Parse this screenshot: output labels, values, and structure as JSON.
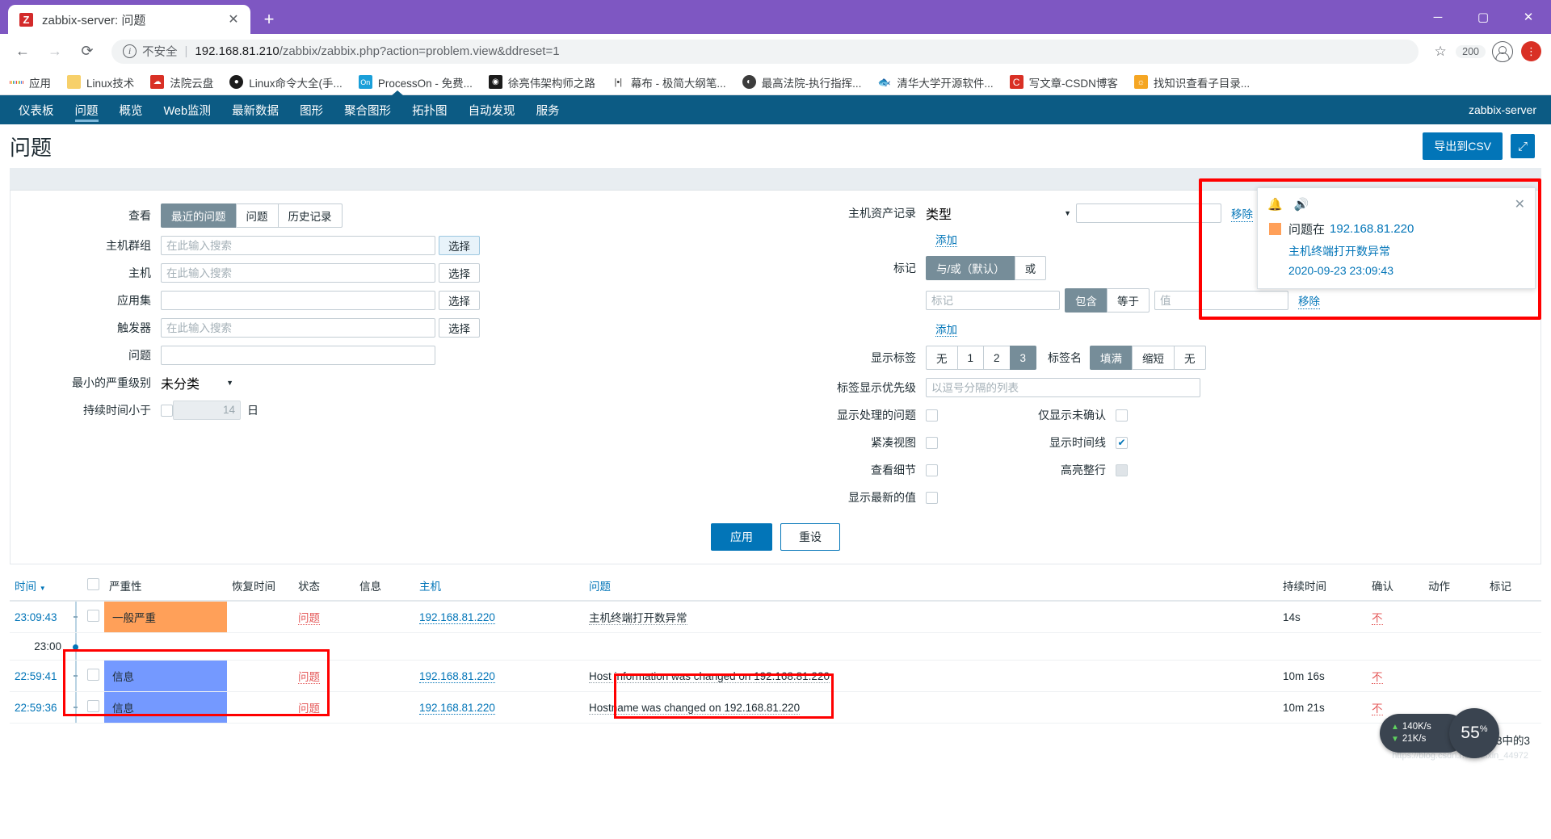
{
  "browser": {
    "tab": {
      "title": "zabbix-server: 问题",
      "favicon_letter": "Z",
      "close_label": "✕"
    },
    "new_tab_label": "+",
    "window": {
      "minimize": "─",
      "maximize": "▢",
      "close": "✕"
    },
    "nav": {
      "back": "←",
      "forward": "→",
      "reload": "⟳"
    },
    "omnibox": {
      "security_label": "不安全",
      "separator": "|",
      "url_host": "192.168.81.210",
      "url_path": "/zabbix/zabbix.php?action=problem.view&ddreset=1",
      "star": "☆"
    },
    "extension_badge": "200",
    "bookmarks": [
      {
        "label": "应用",
        "icon": "apps-grid-icon"
      },
      {
        "label": "Linux技术",
        "icon": "folder-icon"
      },
      {
        "label": "法院云盘",
        "icon": "cloud-disk-icon"
      },
      {
        "label": "Linux命令大全(手...",
        "icon": "redhat-icon"
      },
      {
        "label": "ProcessOn - 免费...",
        "icon": "processon-icon"
      },
      {
        "label": "徐亮伟架构师之路",
        "icon": "chrome-dark-icon"
      },
      {
        "label": "幕布 - 极简大纲笔...",
        "icon": "mubu-icon"
      },
      {
        "label": "最高法院-执行指挥...",
        "icon": "court-icon"
      },
      {
        "label": "清华大学开源软件...",
        "icon": "tuna-icon"
      },
      {
        "label": "写文章-CSDN博客",
        "icon": "csdn-icon"
      },
      {
        "label": "找知识查看子目录...",
        "icon": "knowledge-icon"
      }
    ]
  },
  "zabbix": {
    "nav_items": [
      {
        "label": "仪表板",
        "active": false
      },
      {
        "label": "问题",
        "active": true
      },
      {
        "label": "概览",
        "active": false
      },
      {
        "label": "Web监测",
        "active": false
      },
      {
        "label": "最新数据",
        "active": false
      },
      {
        "label": "图形",
        "active": false
      },
      {
        "label": "聚合图形",
        "active": false
      },
      {
        "label": "拓扑图",
        "active": false
      },
      {
        "label": "自动发现",
        "active": false
      },
      {
        "label": "服务",
        "active": false
      }
    ],
    "server_label": "zabbix-server",
    "page_title": "问题",
    "export_csv_label": "导出到CSV",
    "kiosk_icon": "expand-icon"
  },
  "filter": {
    "view": {
      "label": "查看",
      "options": [
        "最近的问题",
        "问题",
        "历史记录"
      ],
      "selected": "最近的问题"
    },
    "host_group": {
      "label": "主机群组",
      "value": "",
      "placeholder": "在此输入搜索",
      "select_label": "选择"
    },
    "host": {
      "label": "主机",
      "value": "",
      "placeholder": "在此输入搜索",
      "select_label": "选择"
    },
    "app_set": {
      "label": "应用集",
      "value": "",
      "placeholder": "",
      "select_label": "选择"
    },
    "trigger": {
      "label": "触发器",
      "value": "",
      "placeholder": "在此输入搜索",
      "select_label": "选择"
    },
    "problem": {
      "label": "问题",
      "value": "",
      "placeholder": ""
    },
    "min_severity": {
      "label": "最小的严重级别",
      "value": "未分类"
    },
    "duration": {
      "label": "持续时间小于",
      "checked": false,
      "value": "14",
      "unit": "日"
    },
    "inventory": {
      "label": "主机资产记录",
      "type_value": "类型",
      "value": "",
      "remove_label": "移除",
      "add_label": "添加"
    },
    "tags": {
      "label": "标记",
      "mode_options": [
        "与/或（默认）",
        "或"
      ],
      "mode_selected": "与/或（默认）",
      "tag_placeholder": "标记",
      "operator_options": [
        "包含",
        "等于"
      ],
      "operator_selected": "包含",
      "value_placeholder": "值",
      "remove_label": "移除",
      "add_label": "添加"
    },
    "show_tags": {
      "label": "显示标签",
      "options": [
        "无",
        "1",
        "2",
        "3"
      ],
      "selected": "3"
    },
    "tag_name": {
      "label": "标签名",
      "options": [
        "填满",
        "缩短",
        "无"
      ],
      "selected": "填满"
    },
    "tag_priority": {
      "label": "标签显示优先级",
      "value": "",
      "placeholder": "以逗号分隔的列表"
    },
    "checkboxes": [
      {
        "label": "显示处理的问题",
        "checked": false,
        "disabled": false
      },
      {
        "label": "紧凑视图",
        "checked": false,
        "disabled": false
      },
      {
        "label": "查看细节",
        "checked": false,
        "disabled": false
      },
      {
        "label": "显示最新的值",
        "checked": false,
        "disabled": false
      }
    ],
    "checkboxes_right": [
      {
        "label": "仅显示未确认",
        "checked": false,
        "disabled": false
      },
      {
        "label": "显示时间线",
        "checked": true,
        "disabled": false
      },
      {
        "label": "高亮整行",
        "checked": false,
        "disabled": true
      }
    ],
    "apply_label": "应用",
    "reset_label": "重设"
  },
  "table": {
    "headers": [
      "时间",
      "",
      "严重性",
      "恢复时间",
      "状态",
      "信息",
      "主机",
      "问题",
      "持续时间",
      "确认",
      "动作",
      "标记"
    ],
    "sort_indicator": "▼",
    "rows": [
      {
        "time": "23:09:43",
        "severity": "一般严重",
        "severity_class": "sev-average",
        "recovery_time": "",
        "status": "问题",
        "info": "",
        "host": "192.168.81.220",
        "problem": "主机终端打开数异常",
        "duration": "14s",
        "ack": "不",
        "actions": "",
        "tags": ""
      },
      {
        "time": "22:59:41",
        "severity": "信息",
        "severity_class": "sev-info",
        "recovery_time": "",
        "status": "问题",
        "info": "",
        "host": "192.168.81.220",
        "problem": "Host information was changed on 192.168.81.220",
        "duration": "10m 16s",
        "ack": "不",
        "actions": "",
        "tags": ""
      },
      {
        "time": "22:59:36",
        "severity": "信息",
        "severity_class": "sev-info",
        "recovery_time": "",
        "status": "问题",
        "info": "",
        "host": "192.168.81.220",
        "problem": "Hostname was changed on 192.168.81.220",
        "duration": "10m 21s",
        "ack": "不",
        "actions": "",
        "tags": ""
      }
    ],
    "timeline_marker": "23:00",
    "footer": "显示 已自动发现的 3中的3",
    "watermark": "https://blog.csdn.net/weixin_44972"
  },
  "notification": {
    "bell_icon": "bell-icon",
    "sound_icon": "speaker-icon",
    "close_icon": "close-icon",
    "prefix": "问题在",
    "host": "192.168.81.220",
    "problem": "主机终端打开数异常",
    "timestamp": "2020-09-23 23:09:43",
    "severity_color": "#ffa059"
  },
  "net_widget": {
    "upload": "140K/s",
    "download": "21K/s",
    "cpu_value": "55",
    "cpu_unit": "%"
  }
}
